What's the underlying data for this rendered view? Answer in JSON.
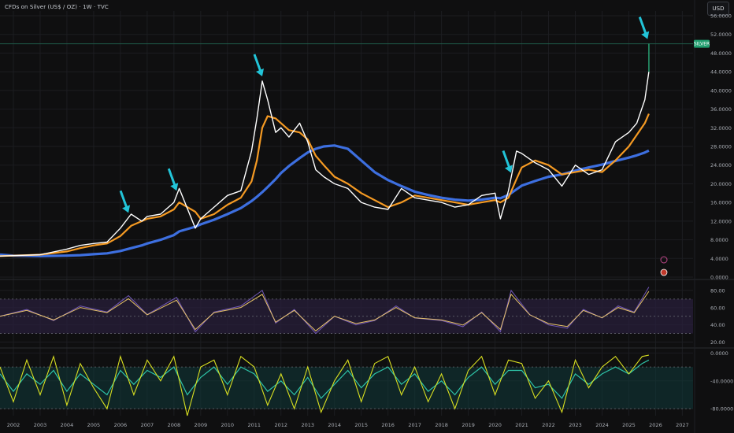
{
  "header": {
    "title": "CFDs on Silver (US$ / OZ) · 1W · TVC",
    "currency": "USD",
    "symbol_tag": "SILVER"
  },
  "colors": {
    "background": "#0f0f10",
    "grid": "#1c1d21",
    "price": "#ffffff",
    "sma_fast": "#f59a23",
    "sma_slow": "#3d6fe0",
    "arrow": "#22c4d8",
    "rsi_line": "#e8c46a",
    "rsi_band": "#2a1f3d",
    "osc_fast": "#d9e021",
    "osc_slow": "#2ec4a8",
    "osc_band": "#103a3a",
    "symbol_tag_bg": "#1f9e6e"
  },
  "chart_data": [
    {
      "type": "line",
      "name": "price_panel",
      "x": [
        2001.5,
        2002,
        2003,
        2004,
        2004.5,
        2005,
        2005.5,
        2006,
        2006.4,
        2006.8,
        2007,
        2007.5,
        2008,
        2008.2,
        2008.8,
        2009,
        2009.5,
        2010,
        2010.5,
        2010.9,
        2011.1,
        2011.3,
        2011.5,
        2011.8,
        2012,
        2012.3,
        2012.7,
        2013,
        2013.3,
        2013.6,
        2014,
        2014.5,
        2015,
        2015.5,
        2016,
        2016.5,
        2017,
        2017.5,
        2018,
        2018.5,
        2019,
        2019.5,
        2020,
        2020.2,
        2020.5,
        2020.8,
        2021,
        2021.5,
        2022,
        2022.5,
        2023,
        2023.5,
        2024,
        2024.5,
        2025,
        2025.3,
        2025.6,
        2025.75
      ],
      "series": [
        {
          "values": [
            4.5,
            4.6,
            4.8,
            6.0,
            6.8,
            7.2,
            7.5,
            10.5,
            13.5,
            12.0,
            13.0,
            13.5,
            16.0,
            19.0,
            10.5,
            12.5,
            15.0,
            17.5,
            18.5,
            27.0,
            34.0,
            42.0,
            38.0,
            31.0,
            32.0,
            30.0,
            33.0,
            29.0,
            23.0,
            21.5,
            20.0,
            19.0,
            16.0,
            15.0,
            14.5,
            19.0,
            17.0,
            16.5,
            16.0,
            15.0,
            15.5,
            17.5,
            18.0,
            12.5,
            18.5,
            27.0,
            26.5,
            24.5,
            23.0,
            19.5,
            24.0,
            22.0,
            23.0,
            29.0,
            31.0,
            33.0,
            38.0,
            44.0
          ]
        },
        {
          "values": [
            4.5,
            4.6,
            4.8,
            5.5,
            6.2,
            6.8,
            7.2,
            8.8,
            11.0,
            12.0,
            12.5,
            13.0,
            14.5,
            16.0,
            14.0,
            12.5,
            13.5,
            15.5,
            17.0,
            20.5,
            25.0,
            32.0,
            34.5,
            34.0,
            33.0,
            31.5,
            31.0,
            29.5,
            26.0,
            24.0,
            21.5,
            20.0,
            18.0,
            16.5,
            15.0,
            16.0,
            17.5,
            17.0,
            16.5,
            16.0,
            15.5,
            16.0,
            16.5,
            16.0,
            17.0,
            21.0,
            23.5,
            25.0,
            24.0,
            22.0,
            22.5,
            23.0,
            22.5,
            25.0,
            28.0,
            30.5,
            33.0,
            35.0
          ]
        },
        {
          "values": [
            4.8,
            4.6,
            4.5,
            4.6,
            4.7,
            4.9,
            5.1,
            5.6,
            6.2,
            6.8,
            7.2,
            8.0,
            9.0,
            9.8,
            10.8,
            11.3,
            12.3,
            13.5,
            14.8,
            16.3,
            17.2,
            18.2,
            19.3,
            21.0,
            22.3,
            23.8,
            25.5,
            26.7,
            27.5,
            28.0,
            28.2,
            27.5,
            25.0,
            22.5,
            20.8,
            19.5,
            18.3,
            17.6,
            17.0,
            16.6,
            16.4,
            16.6,
            17.0,
            16.9,
            17.6,
            18.8,
            19.6,
            20.6,
            21.5,
            22.0,
            22.8,
            23.5,
            24.1,
            24.9,
            25.6,
            26.1,
            26.7,
            27.1
          ]
        }
      ],
      "ylim": [
        0,
        56
      ],
      "y_ticks": [
        "56.0000",
        "52.0000",
        "48.0000",
        "44.0000",
        "40.0000",
        "36.0000",
        "32.0000",
        "28.0000",
        "24.0000",
        "20.0000",
        "16.0000",
        "12.0000",
        "8.0000",
        "4.0000",
        "0.0000"
      ],
      "arrow_markers_x": [
        2006.3,
        2008.1,
        2011.3,
        2020.6,
        2025.7
      ],
      "peak_line_y": 50.0
    },
    {
      "type": "line",
      "name": "rsi_panel",
      "x": [
        2001.5,
        2002.5,
        2003.5,
        2004.5,
        2005.5,
        2006.3,
        2007,
        2008.1,
        2008.8,
        2009.5,
        2010.5,
        2011.3,
        2011.8,
        2012.5,
        2013.3,
        2014,
        2014.8,
        2015.5,
        2016.3,
        2017,
        2018,
        2018.8,
        2019.5,
        2020.2,
        2020.6,
        2021.3,
        2022,
        2022.7,
        2023.3,
        2024,
        2024.6,
        2025.2,
        2025.75
      ],
      "series": [
        {
          "values": [
            50,
            58,
            45,
            62,
            55,
            74,
            52,
            72,
            32,
            55,
            62,
            80,
            42,
            58,
            30,
            50,
            40,
            45,
            62,
            48,
            45,
            38,
            55,
            32,
            80,
            52,
            40,
            36,
            58,
            48,
            62,
            55,
            84
          ]
        }
      ],
      "ylim": [
        15,
        90
      ],
      "y_ticks": [
        "80.00",
        "60.00",
        "40.00",
        "20.00"
      ],
      "bands": [
        30,
        50,
        70
      ]
    },
    {
      "type": "line",
      "name": "oscillator_panel",
      "x": [
        2001.5,
        2002,
        2002.5,
        2003,
        2003.5,
        2004,
        2004.5,
        2005,
        2005.5,
        2006,
        2006.5,
        2007,
        2007.5,
        2008,
        2008.5,
        2009,
        2009.5,
        2010,
        2010.5,
        2011,
        2011.5,
        2012,
        2012.5,
        2013,
        2013.5,
        2014,
        2014.5,
        2015,
        2015.5,
        2016,
        2016.5,
        2017,
        2017.5,
        2018,
        2018.5,
        2019,
        2019.5,
        2020,
        2020.5,
        2021,
        2021.5,
        2022,
        2022.5,
        2023,
        2023.5,
        2024,
        2024.5,
        2025,
        2025.5,
        2025.75
      ],
      "series": [
        {
          "values": [
            -20,
            -70,
            -10,
            -60,
            -5,
            -75,
            -15,
            -50,
            -80,
            -5,
            -60,
            -10,
            -40,
            -5,
            -90,
            -20,
            -10,
            -60,
            -5,
            -20,
            -75,
            -30,
            -80,
            -20,
            -85,
            -40,
            -10,
            -70,
            -15,
            -5,
            -60,
            -20,
            -70,
            -30,
            -80,
            -25,
            -5,
            -60,
            -10,
            -15,
            -65,
            -40,
            -85,
            -10,
            -50,
            -20,
            -5,
            -30,
            -5,
            -3
          ]
        },
        {
          "values": [
            -30,
            -55,
            -30,
            -45,
            -25,
            -55,
            -30,
            -45,
            -60,
            -25,
            -45,
            -25,
            -35,
            -20,
            -60,
            -35,
            -20,
            -45,
            -20,
            -30,
            -55,
            -40,
            -60,
            -35,
            -65,
            -45,
            -25,
            -50,
            -30,
            -20,
            -45,
            -30,
            -55,
            -40,
            -60,
            -35,
            -20,
            -45,
            -25,
            -25,
            -50,
            -45,
            -65,
            -30,
            -45,
            -30,
            -20,
            -30,
            -15,
            -10
          ]
        }
      ],
      "ylim": [
        -90,
        5
      ],
      "y_ticks": [
        "0.0000",
        "-40.0000",
        "-80.0000"
      ],
      "bands": [
        -20,
        -80
      ]
    }
  ],
  "x_axis_labels": [
    "2002",
    "2003",
    "2004",
    "2005",
    "2006",
    "2007",
    "2008",
    "2009",
    "2010",
    "2011",
    "2012",
    "2013",
    "2014",
    "2015",
    "2016",
    "2017",
    "2018",
    "2019",
    "2020",
    "2021",
    "2022",
    "2023",
    "2024",
    "2025",
    "2026",
    "2027"
  ]
}
